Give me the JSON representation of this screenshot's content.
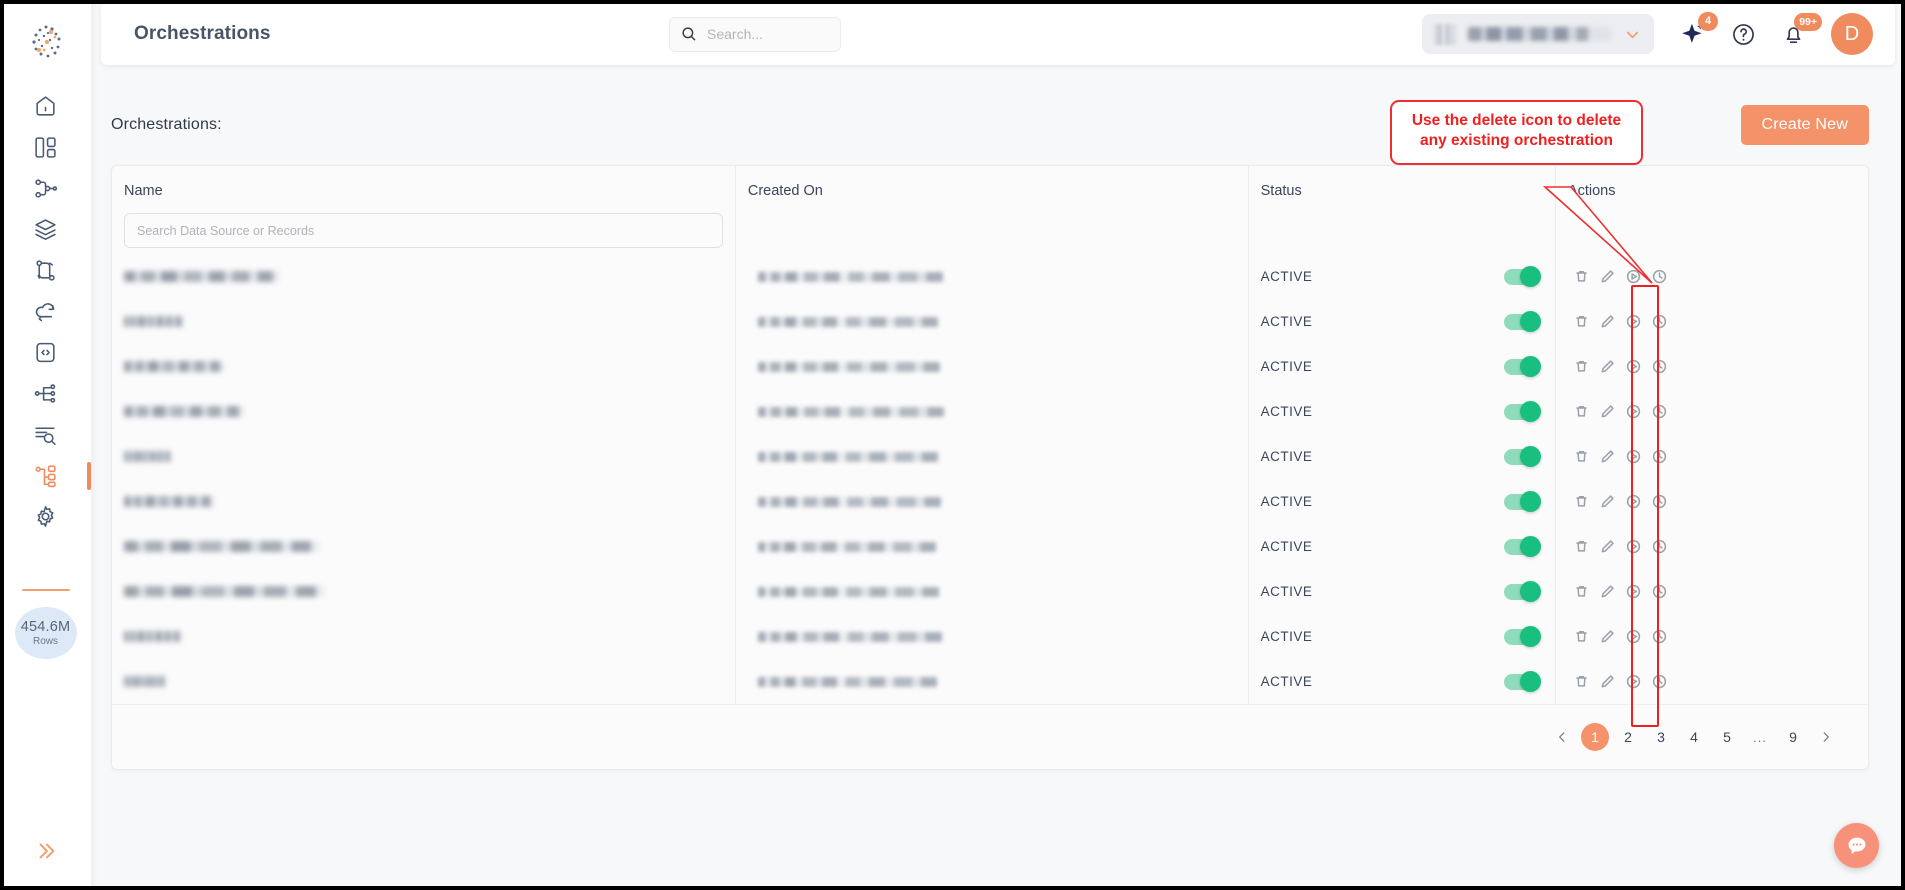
{
  "app": {
    "page_title": "Orchestrations",
    "accent_color": "#f4936a",
    "active_toggle_color": "#18bf7f",
    "annotation_color": "#ef2020"
  },
  "topbar": {
    "search": {
      "placeholder": "Search...",
      "value": ""
    },
    "workspace": {
      "label": "",
      "redacted": true
    },
    "ai_badge": "4",
    "notification_badge": "99+",
    "avatar_initial": "D"
  },
  "sidebar": {
    "items": [
      {
        "name": "home",
        "label": "Home",
        "active": false
      },
      {
        "name": "dashboard",
        "label": "Dashboard",
        "active": false
      },
      {
        "name": "pipelines",
        "label": "Pipelines",
        "active": false
      },
      {
        "name": "datasets",
        "label": "Datasets",
        "active": false
      },
      {
        "name": "workflows",
        "label": "Workflows",
        "active": false
      },
      {
        "name": "sync",
        "label": "Sync",
        "active": false
      },
      {
        "name": "code",
        "label": "Code",
        "active": false
      },
      {
        "name": "connections",
        "label": "Connections",
        "active": false
      },
      {
        "name": "query",
        "label": "Query",
        "active": false
      },
      {
        "name": "orchestration",
        "label": "Orchestration",
        "active": true
      },
      {
        "name": "settings",
        "label": "Settings",
        "active": false
      }
    ],
    "rows_counter": {
      "value": "454.6M",
      "unit": "Rows"
    }
  },
  "content": {
    "section_label": "Orchestrations:",
    "create_button": "Create New"
  },
  "table": {
    "columns": [
      "Name",
      "Created On",
      "Status",
      "Actions"
    ],
    "name_filter_placeholder": "Search Data Source or Records",
    "row_status_label": "ACTIVE",
    "action_icons": [
      "delete-icon",
      "edit-icon",
      "run-icon",
      "history-icon"
    ],
    "rows": [
      {
        "name": "",
        "created_on": "",
        "status": "ACTIVE",
        "enabled": true,
        "redacted": true
      },
      {
        "name": "",
        "created_on": "",
        "status": "ACTIVE",
        "enabled": true,
        "redacted": true
      },
      {
        "name": "",
        "created_on": "",
        "status": "ACTIVE",
        "enabled": true,
        "redacted": true
      },
      {
        "name": "",
        "created_on": "",
        "status": "ACTIVE",
        "enabled": true,
        "redacted": true
      },
      {
        "name": "",
        "created_on": "",
        "status": "ACTIVE",
        "enabled": true,
        "redacted": true
      },
      {
        "name": "",
        "created_on": "",
        "status": "ACTIVE",
        "enabled": true,
        "redacted": true
      },
      {
        "name": "",
        "created_on": "",
        "status": "ACTIVE",
        "enabled": true,
        "redacted": true
      },
      {
        "name": "",
        "created_on": "",
        "status": "ACTIVE",
        "enabled": true,
        "redacted": true
      },
      {
        "name": "",
        "created_on": "",
        "status": "ACTIVE",
        "enabled": true,
        "redacted": true
      },
      {
        "name": "",
        "created_on": "",
        "status": "ACTIVE",
        "enabled": true,
        "redacted": true
      }
    ]
  },
  "pagination": {
    "prev": "‹",
    "next": "›",
    "pages": [
      "1",
      "2",
      "3",
      "4",
      "5",
      "...",
      "9"
    ],
    "current": "1"
  },
  "annotation": {
    "callout_text": "Use the delete icon to delete any existing orchestration"
  }
}
